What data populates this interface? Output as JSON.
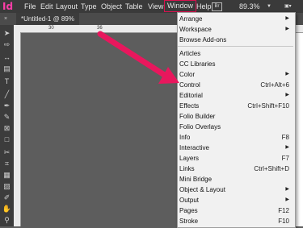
{
  "app_logo": "Id",
  "menubar": {
    "items": [
      "File",
      "Edit",
      "Layout",
      "Type",
      "Object",
      "Table",
      "View",
      "Window",
      "Help"
    ],
    "active": "Window",
    "bridge_label": "Br",
    "zoom": "89.3%"
  },
  "document_tab": {
    "title": "*Untitled-1 @ 89%",
    "close": "×"
  },
  "ruler": {
    "labels": [
      "30",
      "36"
    ]
  },
  "window_menu": {
    "items": [
      {
        "label": "Arrange",
        "shortcut": "",
        "submenu": true
      },
      {
        "label": "Workspace",
        "shortcut": "",
        "submenu": true
      },
      {
        "label": "Browse Add-ons",
        "shortcut": "",
        "submenu": false
      },
      {
        "label": "Articles",
        "shortcut": "",
        "submenu": false
      },
      {
        "label": "CC Libraries",
        "shortcut": "",
        "submenu": false
      },
      {
        "label": "Color",
        "shortcut": "",
        "submenu": true
      },
      {
        "label": "Control",
        "shortcut": "Ctrl+Alt+6",
        "submenu": false
      },
      {
        "label": "Editorial",
        "shortcut": "",
        "submenu": true
      },
      {
        "label": "Effects",
        "shortcut": "Ctrl+Shift+F10",
        "submenu": false
      },
      {
        "label": "Folio Builder",
        "shortcut": "",
        "submenu": false
      },
      {
        "label": "Folio Overlays",
        "shortcut": "",
        "submenu": false
      },
      {
        "label": "Info",
        "shortcut": "F8",
        "submenu": false
      },
      {
        "label": "Interactive",
        "shortcut": "",
        "submenu": true
      },
      {
        "label": "Layers",
        "shortcut": "F7",
        "submenu": false
      },
      {
        "label": "Links",
        "shortcut": "Ctrl+Shift+D",
        "submenu": false
      },
      {
        "label": "Mini Bridge",
        "shortcut": "",
        "submenu": false
      },
      {
        "label": "Object & Layout",
        "shortcut": "",
        "submenu": true
      },
      {
        "label": "Output",
        "shortcut": "",
        "submenu": true
      },
      {
        "label": "Pages",
        "shortcut": "F12",
        "submenu": false
      },
      {
        "label": "Stroke",
        "shortcut": "F10",
        "submenu": false
      }
    ]
  },
  "page_text_fragments": [
    "ve",
    "se",
    "ia",
    "su",
    "pi",
    "e,",
    "uc",
    "pi",
    "ra",
    "lla",
    "no",
    "ect",
    "re",
    "m"
  ],
  "colors": {
    "accent": "#d9114f",
    "arrow": "#e8175d",
    "logo": "#ff3ea8"
  }
}
